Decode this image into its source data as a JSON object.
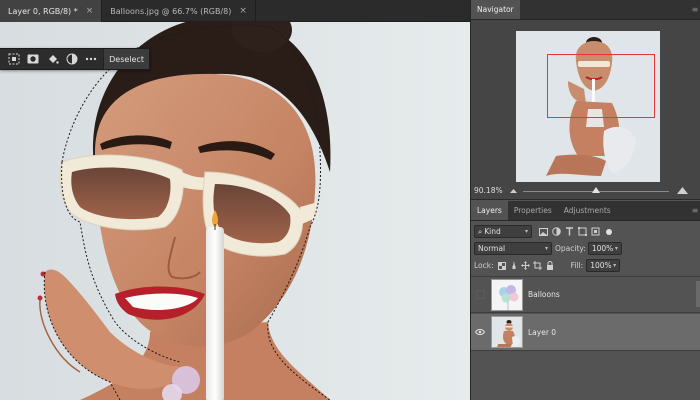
{
  "tabs": [
    {
      "label": "Layer 0, RGB/8) *",
      "close": "×",
      "active": true
    },
    {
      "label": "Balloons.jpg @ 66.7% (RGB/8)",
      "close": "×",
      "active": false
    }
  ],
  "taskbar": {
    "icons": [
      "transform-selection-icon",
      "mask-icon",
      "fill-icon",
      "adjustment-icon",
      "more-icon"
    ],
    "deselect_label": "Deselect"
  },
  "navigator": {
    "title": "Navigator",
    "zoom": "90.18%",
    "slider_fraction": 0.5
  },
  "layers_panel": {
    "tabs": [
      "Layers",
      "Properties",
      "Adjustments"
    ],
    "active_tab": "Layers",
    "filter": {
      "value": "Kind",
      "icons": [
        "image-filter-icon",
        "adjustment-filter-icon",
        "type-filter-icon",
        "shape-filter-icon",
        "smart-object-filter-icon",
        "filter-toggle-icon"
      ]
    },
    "blend": {
      "value": "Normal",
      "opacity_label": "Opacity:",
      "opacity": "100%"
    },
    "lock": {
      "label": "Lock:",
      "icons": [
        "lock-transparent-icon",
        "lock-paint-icon",
        "lock-move-icon",
        "lock-artboard-icon",
        "lock-all-icon"
      ],
      "fill_label": "Fill:",
      "fill": "100%"
    },
    "layers": [
      {
        "name": "Balloons",
        "visible": false,
        "selected": false
      },
      {
        "name": "Layer 0",
        "visible": true,
        "selected": true
      }
    ]
  },
  "colors": {
    "panel_bg": "#535353",
    "selection_border": "#e8363c",
    "lipstick": "#b5202a",
    "glasses_frame": "#f1ead9"
  }
}
